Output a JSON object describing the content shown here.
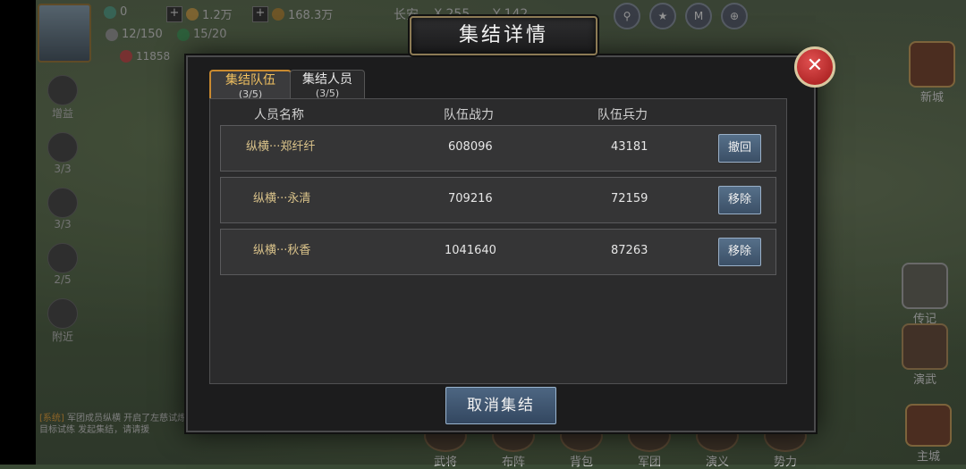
{
  "hud": {
    "resource_1": "0",
    "resource_2": "1.2万",
    "resource_3": "168.3万",
    "coord_place": "长安",
    "coord_x_label": "X",
    "coord_x": "255",
    "coord_y_label": "Y",
    "coord_y": "142",
    "stamina": "12/150",
    "troops": "15/20",
    "power": "11858"
  },
  "left_side": [
    {
      "label": "增益"
    },
    {
      "label": "3/3"
    },
    {
      "label": "3/3"
    },
    {
      "label": "2/5"
    },
    {
      "label": "附近"
    }
  ],
  "right_side": [
    {
      "label": "新城"
    },
    {
      "label": "传记"
    },
    {
      "label": "演武"
    },
    {
      "label": "主城"
    }
  ],
  "bottom_nav": [
    "武将",
    "布阵",
    "背包",
    "军团",
    "演义",
    "势力"
  ],
  "chat": {
    "tag": "[系统]",
    "text": "军团成员纵横 开启了左慈试炼，并对目标试练 发起集结，请请援"
  },
  "modal": {
    "title": "集结详情",
    "tabs": [
      {
        "label": "集结队伍",
        "sub": "(3/5)",
        "active": true
      },
      {
        "label": "集结人员",
        "sub": "(3/5)",
        "active": false
      }
    ],
    "columns": [
      "人员名称",
      "队伍战力",
      "队伍兵力"
    ],
    "rows": [
      {
        "name": "纵横···郑纤纤",
        "power": "608096",
        "troops": "43181",
        "action": "撤回"
      },
      {
        "name": "纵横···永清",
        "power": "709216",
        "troops": "72159",
        "action": "移除"
      },
      {
        "name": "纵横···秋香",
        "power": "1041640",
        "troops": "87263",
        "action": "移除"
      }
    ],
    "cancel_label": "取消集结",
    "close_symbol": "✕"
  }
}
